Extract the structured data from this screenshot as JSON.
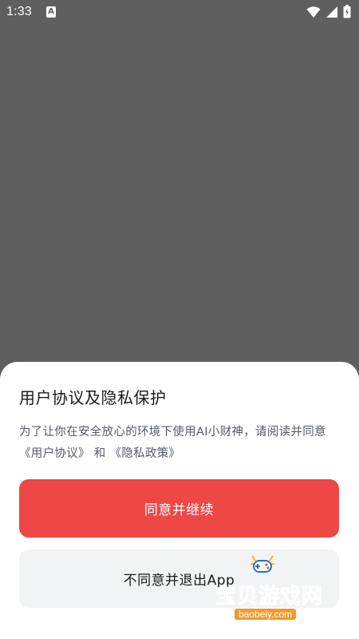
{
  "status_bar": {
    "time": "1:33",
    "app_icon_letter": "A"
  },
  "dialog": {
    "title": "用户协议及隐私保护",
    "description_prefix": "为了让你在安全放心的环境下使用AI小财神，请阅读并同意 ",
    "user_agreement_link": "《用户协议》",
    "conjunction": " 和 ",
    "privacy_policy_link": "《隐私政策》",
    "agree_button_label": "同意并继续",
    "disagree_button_label": "不同意并退出App"
  },
  "watermark": {
    "site_name": "宝贝游戏网",
    "site_url": "baobeiy.com"
  },
  "colors": {
    "overlay": "#5f5f5f",
    "primary_button": "#ef4646",
    "secondary_button": "#f2f3f5",
    "watermark": "#f29a2e"
  }
}
